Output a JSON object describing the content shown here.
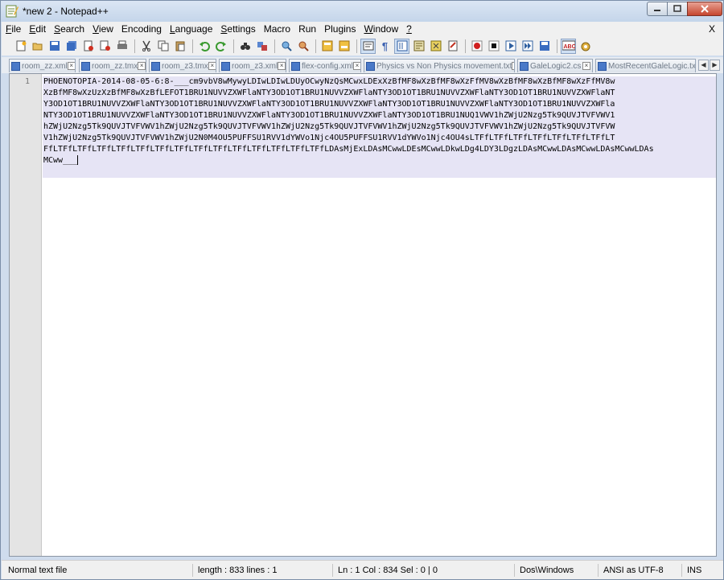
{
  "window": {
    "title": "*new  2 - Notepad++"
  },
  "menu": {
    "items": [
      {
        "label": "File",
        "acc": "F",
        "rest": "ile"
      },
      {
        "label": "Edit",
        "acc": "E",
        "rest": "dit"
      },
      {
        "label": "Search",
        "acc": "S",
        "rest": "earch"
      },
      {
        "label": "View",
        "acc": "V",
        "rest": "iew"
      },
      {
        "label": "Encoding",
        "acc": "",
        "rest": "Encoding"
      },
      {
        "label": "Language",
        "acc": "L",
        "rest": "anguage"
      },
      {
        "label": "Settings",
        "acc": "S",
        "rest": "ettings"
      },
      {
        "label": "Macro",
        "acc": "",
        "rest": "Macro"
      },
      {
        "label": "Run",
        "acc": "",
        "rest": "Run"
      },
      {
        "label": "Plugins",
        "acc": "",
        "rest": "Plugins"
      },
      {
        "label": "Window",
        "acc": "W",
        "rest": "indow"
      },
      {
        "label": "?",
        "acc": "?",
        "rest": ""
      }
    ],
    "close_label": "X"
  },
  "tabs": [
    {
      "label": "room_zz.xml"
    },
    {
      "label": "room_zz.tmx"
    },
    {
      "label": "room_z3.tmx"
    },
    {
      "label": "room_z3.xml"
    },
    {
      "label": "flex-config.xml"
    },
    {
      "label": "Physics vs Non Physics movement.txt"
    },
    {
      "label": "GaleLogic2.cs"
    },
    {
      "label": "MostRecentGaleLogic.txt"
    }
  ],
  "editor": {
    "line_number": "1",
    "wrapped_lines": [
      "PHOENOTOPIA-2014-08-05-6:8-___cm9vbV8wMywyLDIwLDIwLDUyOCwyNzQsMCwxLDExXzBfMF8wXzBfMF8wXzFfMV8wXzBfMF8wXzBfMF8wXzFfMV8w",
      "XzBfMF8wXzUzXzBfMF8wXzBfLEFOT1BRU1NUVVZXWFlaNTY3OD1OT1BRU1NUVVZXWFlaNTY3OD1OT1BRU1NUVVZXWFlaNTY3OD1OT1BRU1NUVVZXWFlaNT",
      "Y3OD1OT1BRU1NUVVZXWFlaNTY3OD1OT1BRU1NUVVZXWFlaNTY3OD1OT1BRU1NUVVZXWFlaNTY3OD1OT1BRU1NUVVZXWFlaNTY3OD1OT1BRU1NUVVZXWFla",
      "NTY3OD1OT1BRU1NUVVZXWFlaNTY3OD1OT1BRU1NUVVZXWFlaNTY3OD1OT1BRU1NUVVZXWFlaNTY3OD1OT1BRU1NUQ1VWV1hZWjU2Nzg5Tk9QUVJTVFVWV1",
      "hZWjU2Nzg5Tk9QUVJTVFVWV1hZWjU2Nzg5Tk9QUVJTVFVWV1hZWjU2Nzg5Tk9QUVJTVFVWV1hZWjU2Nzg5Tk9QUVJTVFVWV1hZWjU2Nzg5Tk9QUVJTVFVW",
      "V1hZWjU2Nzg5Tk9QUVJTVFVWV1hZWjU2N0M4OU5PUFFSU1RVV1dYWVo1Njc4OU5PUFFSU1RVV1dYWVo1Njc4OU4sLTFfLTFfLTFfLTFfLTFfLTFfLTFfLT",
      "FfLTFfLTFfLTFfLTFfLTFfLTFfLTFfLTFfLTFfLTFfLTFfLTFfLTFfLTFfLDAsMjExLDAsMCwwLDEsMCwwLDkwLDg4LDY3LDgzLDAsMCwwLDAsMCwwLDAsMCwwLDAs",
      "MCww___"
    ]
  },
  "status": {
    "file_type": "Normal text file",
    "length": "length : 833    lines : 1",
    "position": "Ln : 1    Col : 834    Sel : 0 | 0",
    "eol": "Dos\\Windows",
    "encoding": "ANSI as UTF-8",
    "mode": "INS"
  }
}
